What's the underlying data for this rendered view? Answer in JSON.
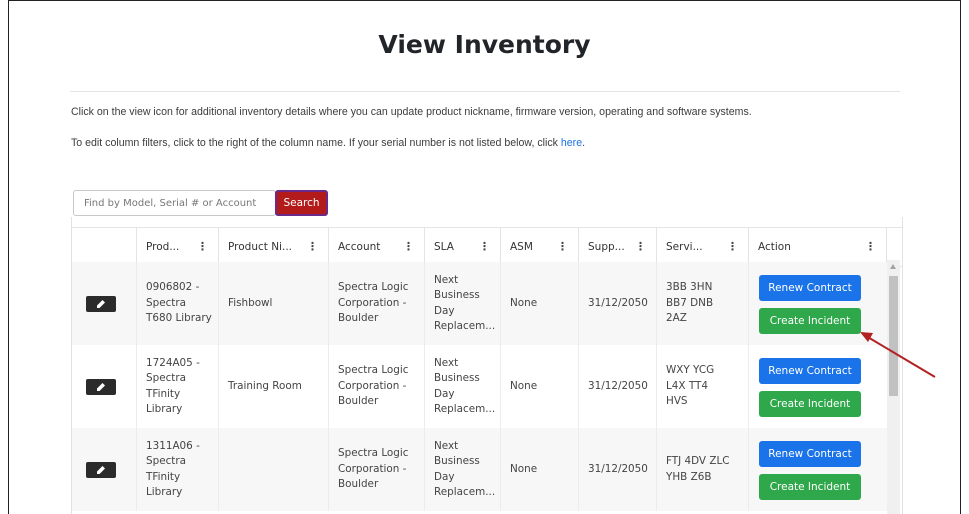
{
  "page": {
    "title": "View Inventory",
    "info_line1": "Click on the view icon for additional inventory details where you can update product nickname, firmware version, operating and software systems.",
    "info_line2_prefix": "To edit column filters, click to the right of the column name. If your serial number is not listed below, click ",
    "info_line2_link": "here",
    "info_line2_suffix": "."
  },
  "search": {
    "placeholder": "Find by Model, Serial # or Account",
    "button_label": "Search"
  },
  "table": {
    "columns": [
      "",
      "Prod...",
      "Product Ni...",
      "Account",
      "SLA",
      "ASM",
      "Supp...",
      "Servi...",
      "Action"
    ],
    "rows": [
      {
        "product": "0906802 -\nSpectra\nT680 Library",
        "nickname": "Fishbowl",
        "account": "Spectra Logic\nCorporation -\nBoulder",
        "sla": "Next\nBusiness\nDay\nReplacem...",
        "asm": "None",
        "support": "31/12/2050",
        "service": "3BB 3HN\nBB7 DNB\n2AZ"
      },
      {
        "product": "1724A05 -\nSpectra\nTFinity\nLibrary",
        "nickname": "Training Room",
        "account": "Spectra Logic\nCorporation -\nBoulder",
        "sla": "Next\nBusiness\nDay\nReplacem...",
        "asm": "None",
        "support": "31/12/2050",
        "service": "WXY YCG\nL4X TT4\nHVS"
      },
      {
        "product": "1311A06 -\nSpectra\nTFinity\nLibrary",
        "nickname": "",
        "account": "Spectra Logic\nCorporation -\nBoulder",
        "sla": "Next\nBusiness\nDay\nReplacem...",
        "asm": "None",
        "support": "31/12/2050",
        "service": "FTJ 4DV ZLC\nYHB Z6B"
      }
    ],
    "renew_label": "Renew Contract",
    "create_label": "Create Incident"
  },
  "icons": {
    "view": "edit-view-icon",
    "kebab": "kebab-menu-icon",
    "annotation": "red-arrow-annotation"
  },
  "colors": {
    "search_button": "#b31b1b",
    "renew_button": "#1a73e8",
    "create_button": "#2ea84a",
    "link": "#1a73e8",
    "arrow": "#b22222"
  }
}
